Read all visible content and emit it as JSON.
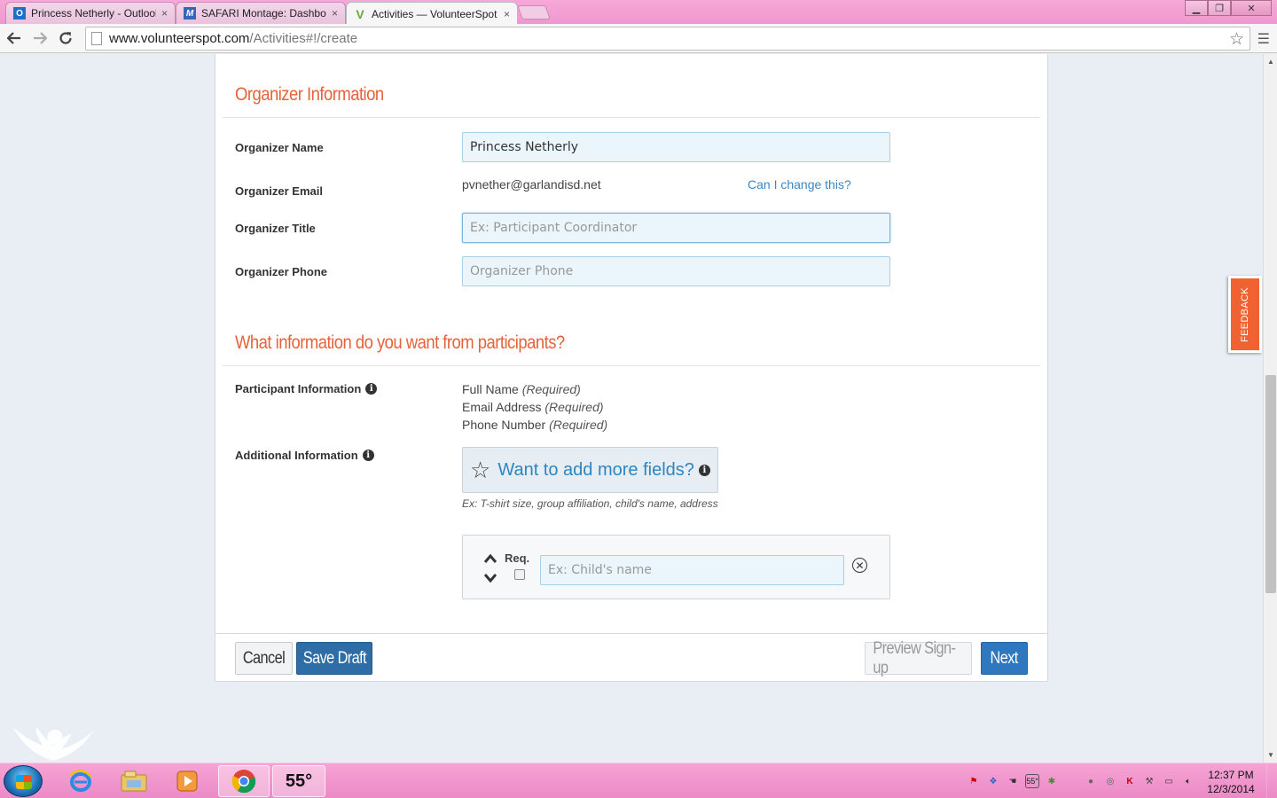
{
  "browser": {
    "tabs": [
      {
        "title": "Princess Netherly - Outlook",
        "icon": "outlook-icon",
        "active": false
      },
      {
        "title": "SAFARI Montage: Dashboard",
        "icon": "safari-montage-icon",
        "active": false
      },
      {
        "title": "Activities — VolunteerSpot",
        "icon": "volunteerspot-icon",
        "active": true
      }
    ],
    "url_host": "www.volunteerspot.com",
    "url_path": "/Activities#!/create",
    "close_glyph": "×",
    "minimize_glyph": "▁",
    "restore_glyph": "❐",
    "window_close_glyph": "✕"
  },
  "organizer": {
    "section_title": "Organizer Information",
    "name_label": "Organizer Name",
    "name_value": "Princess Netherly",
    "email_label": "Organizer Email",
    "email_value": "pvnether@garlandisd.net",
    "email_change_link": "Can I change this?",
    "title_label": "Organizer Title",
    "title_placeholder": "Ex: Participant Coordinator",
    "phone_label": "Organizer Phone",
    "phone_placeholder": "Organizer Phone"
  },
  "participants": {
    "section_title": "What information do you want from participants?",
    "info_label": "Participant Information",
    "required_fields": [
      {
        "name": "Full Name",
        "tag": "(Required)"
      },
      {
        "name": "Email Address",
        "tag": "(Required)"
      },
      {
        "name": "Phone Number",
        "tag": "(Required)"
      }
    ],
    "additional_label": "Additional Information",
    "add_fields_button": "Want to add more fields?",
    "add_fields_hint": "Ex: T-shirt size, group affiliation, child's name, address",
    "field_row": {
      "req_label": "Req.",
      "placeholder": "Ex: Child's name",
      "required_checked": false
    }
  },
  "footer": {
    "cancel": "Cancel",
    "save_draft": "Save Draft",
    "preview": "Preview Sign-up",
    "next": "Next"
  },
  "feedback_tab": "FEEDBACK",
  "taskbar": {
    "weather": "55°",
    "tray_temp": "55°",
    "clock_time": "12:37 PM",
    "clock_date": "12/3/2014"
  },
  "colors": {
    "accent_orange": "#e5623a",
    "link_blue": "#3b86c2",
    "primary_button": "#2f6da6",
    "feedback_bg": "#f06232"
  }
}
